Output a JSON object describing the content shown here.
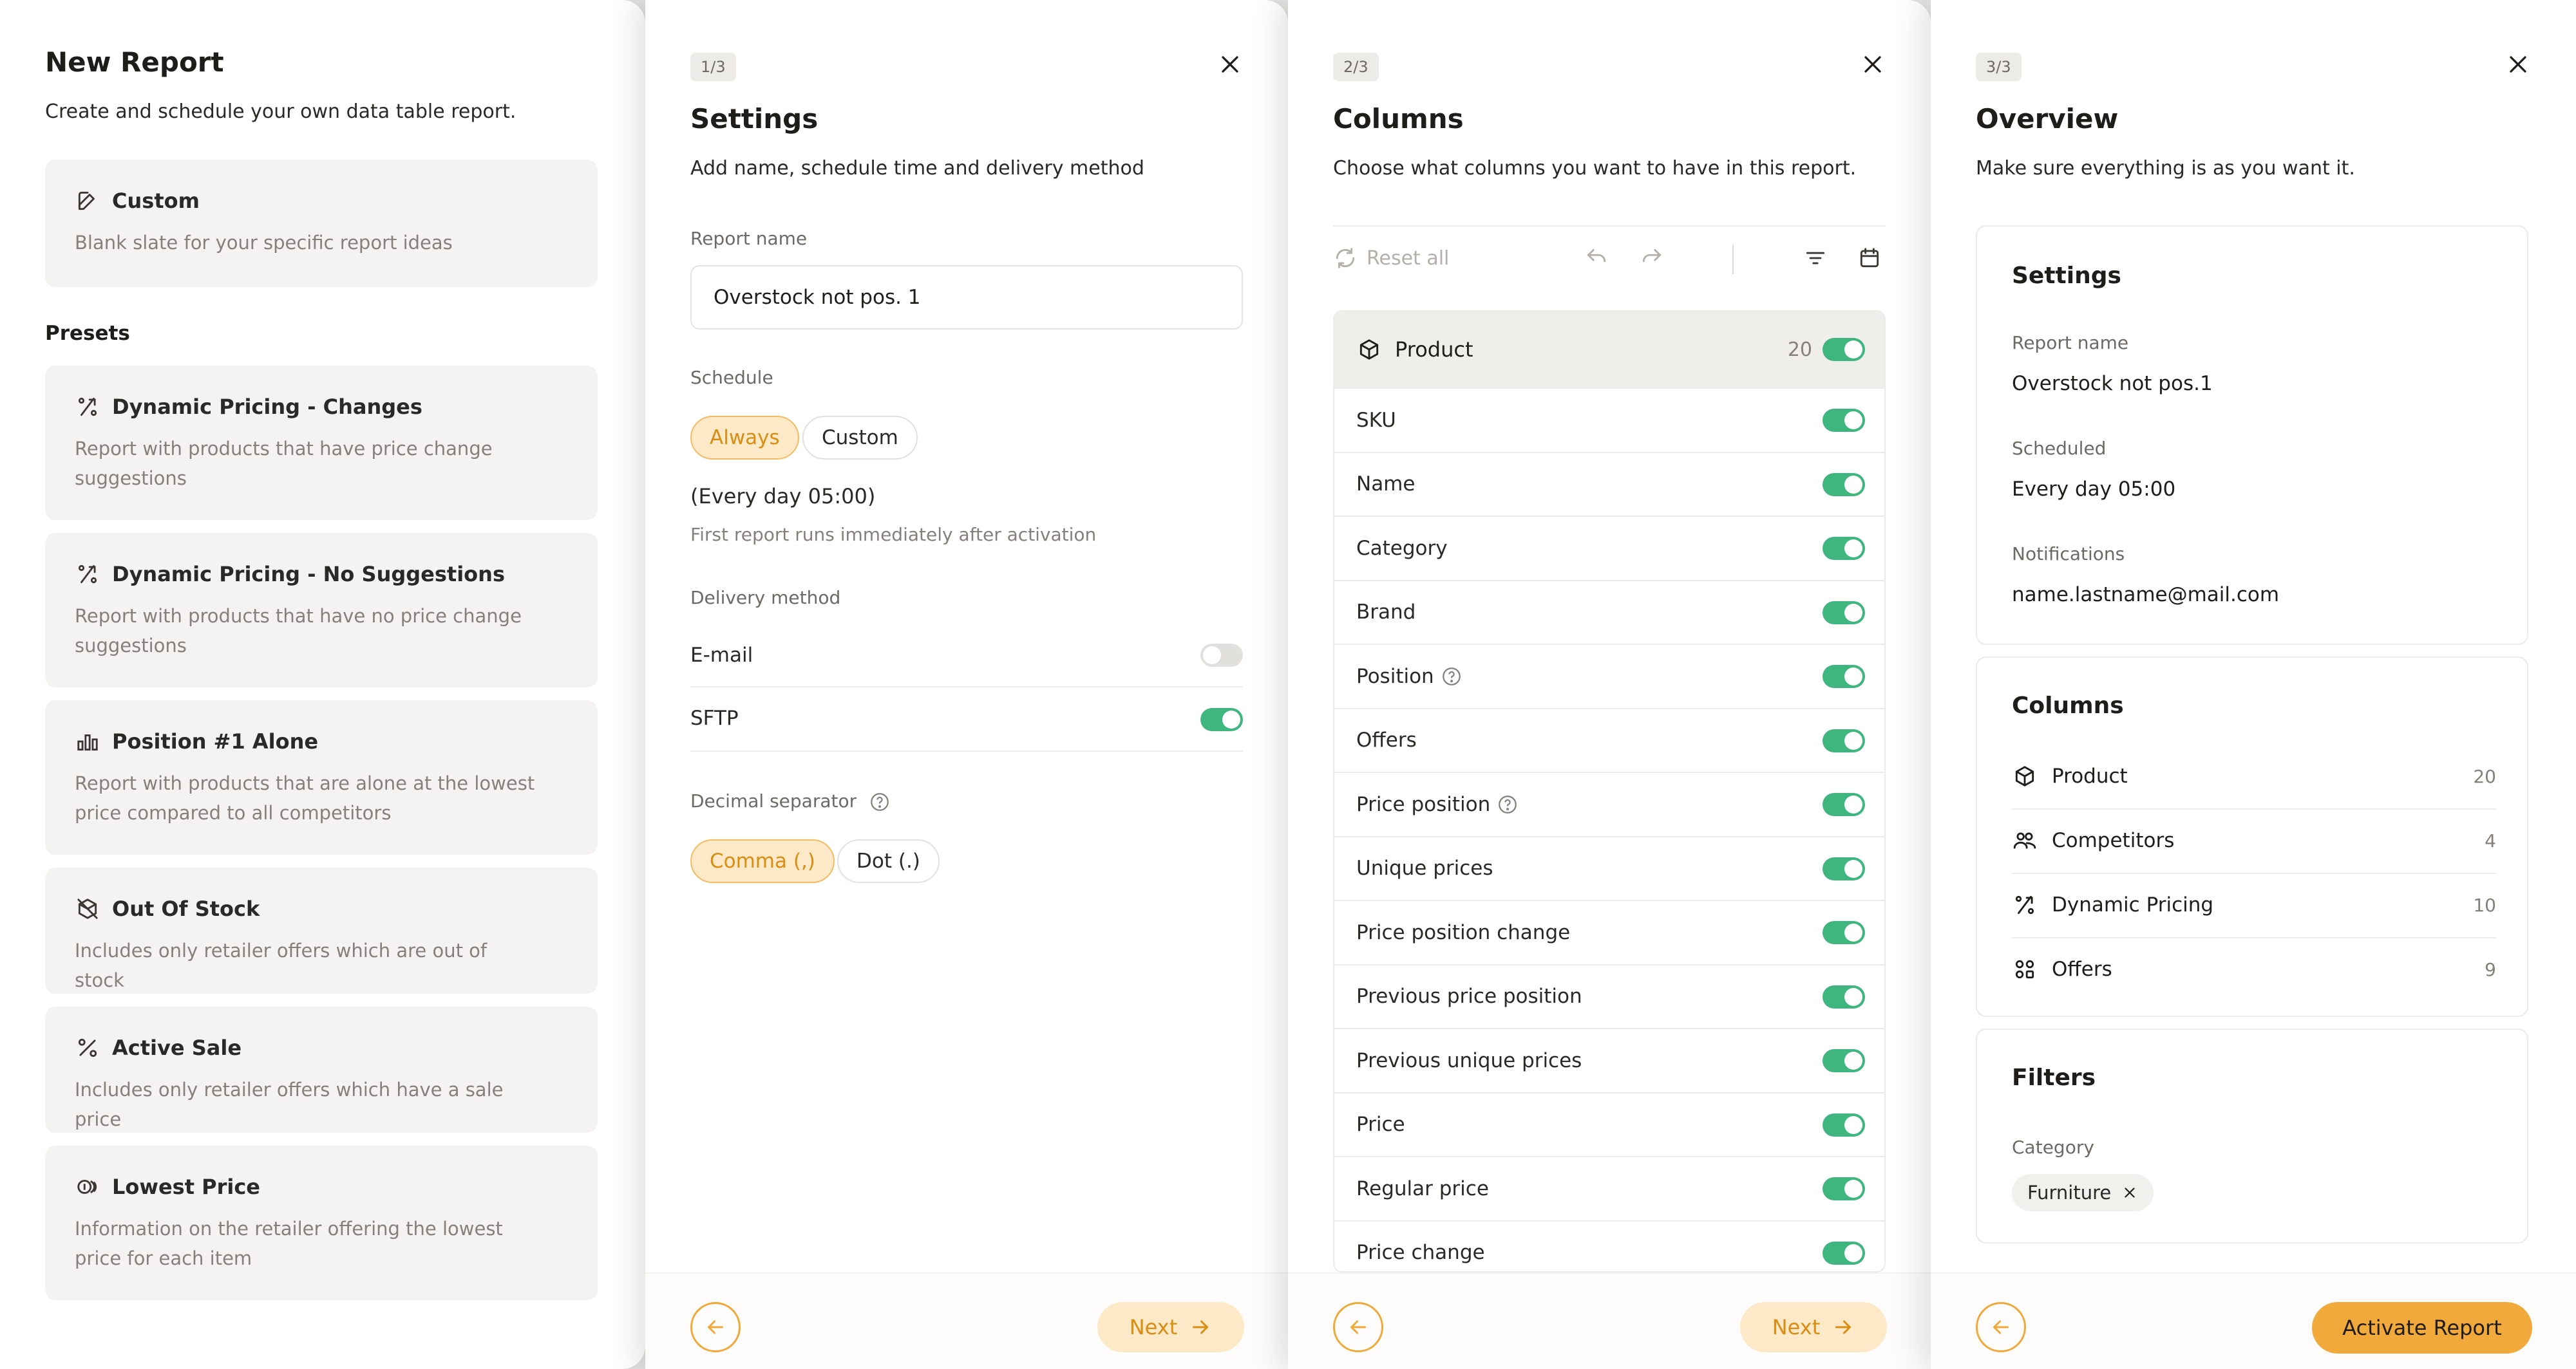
{
  "panel_new_report": {
    "title": "New Report",
    "subtitle": "Create and schedule your own data table report.",
    "custom": {
      "title": "Custom",
      "description": "Blank slate for your specific report ideas",
      "icon": "edit-icon"
    },
    "presets_label": "Presets",
    "presets": [
      {
        "title": "Dynamic Pricing - Changes",
        "description": "Report with products that have price change suggestions",
        "icon": "dynamic-pricing-icon"
      },
      {
        "title": "Dynamic Pricing - No Suggestions",
        "description": "Report with products that have no price change suggestions",
        "icon": "dynamic-pricing-icon"
      },
      {
        "title": "Position #1 Alone",
        "description": "Report with products that are alone at the lowest price compared to all competitors",
        "icon": "bar-chart-icon"
      },
      {
        "title": "Out Of Stock",
        "description": "Includes only retailer offers which are out of stock",
        "icon": "box-off-icon"
      },
      {
        "title": "Active Sale",
        "description": "Includes only retailer offers which have a sale price",
        "icon": "percent-icon"
      },
      {
        "title": "Lowest Price",
        "description": "Information on the retailer offering the lowest price for each item",
        "icon": "coins-icon"
      }
    ]
  },
  "panel_settings": {
    "step": "1/3",
    "title": "Settings",
    "subtitle": "Add name, schedule time and delivery method",
    "report_name_label": "Report name",
    "report_name_value": "Overstock not pos. 1",
    "schedule_label": "Schedule",
    "schedule_options": [
      "Always",
      "Custom"
    ],
    "schedule_selected": "Always",
    "schedule_text": "(Every day 05:00)",
    "schedule_note": "First report runs immediately after activation",
    "delivery_label": "Delivery method",
    "delivery_methods": [
      {
        "name": "E-mail",
        "enabled": false
      },
      {
        "name": "SFTP",
        "enabled": true
      }
    ],
    "decimal_label": "Decimal separator",
    "decimal_options": [
      "Comma (,)",
      "Dot (.)"
    ],
    "decimal_selected": "Comma (,)",
    "next_label": "Next"
  },
  "panel_columns": {
    "step": "2/3",
    "title": "Columns",
    "subtitle": "Choose what columns you want to have in this report.",
    "reset_label": "Reset all",
    "group": {
      "name": "Product",
      "count": "20",
      "icon": "box-icon",
      "enabled": true
    },
    "columns": [
      {
        "name": "SKU",
        "help": false
      },
      {
        "name": "Name",
        "help": false
      },
      {
        "name": "Category",
        "help": false
      },
      {
        "name": "Brand",
        "help": false
      },
      {
        "name": "Position",
        "help": true
      },
      {
        "name": "Offers",
        "help": false
      },
      {
        "name": "Price position",
        "help": true
      },
      {
        "name": "Unique prices",
        "help": false
      },
      {
        "name": "Price position change",
        "help": false
      },
      {
        "name": "Previous price position",
        "help": false
      },
      {
        "name": "Previous unique prices",
        "help": false
      },
      {
        "name": "Price",
        "help": false
      },
      {
        "name": "Regular price",
        "help": false
      },
      {
        "name": "Price change",
        "help": false
      }
    ],
    "next_label": "Next"
  },
  "panel_overview": {
    "step": "3/3",
    "title": "Overview",
    "subtitle": "Make sure everything is as you want it.",
    "settings": {
      "title": "Settings",
      "report_name_label": "Report name",
      "report_name_value": "Overstock not pos.1",
      "scheduled_label": "Scheduled",
      "scheduled_value": "Every day 05:00",
      "notifications_label": "Notifications",
      "notifications_value": "name.lastname@mail.com"
    },
    "columns": {
      "title": "Columns",
      "groups": [
        {
          "name": "Product",
          "count": "20",
          "icon": "box-icon"
        },
        {
          "name": "Competitors",
          "count": "4",
          "icon": "users-icon"
        },
        {
          "name": "Dynamic Pricing",
          "count": "10",
          "icon": "dynamic-pricing-icon"
        },
        {
          "name": "Offers",
          "count": "9",
          "icon": "offers-icon"
        }
      ]
    },
    "filters": {
      "title": "Filters",
      "category_label": "Category",
      "category_chip": "Furniture"
    },
    "activate_label": "Activate Report"
  },
  "colors": {
    "accent": "#f2a93b",
    "accent_light": "#fde9c7",
    "toggle_on": "#3fb57f",
    "toggle_off": "#e2e0dc"
  }
}
